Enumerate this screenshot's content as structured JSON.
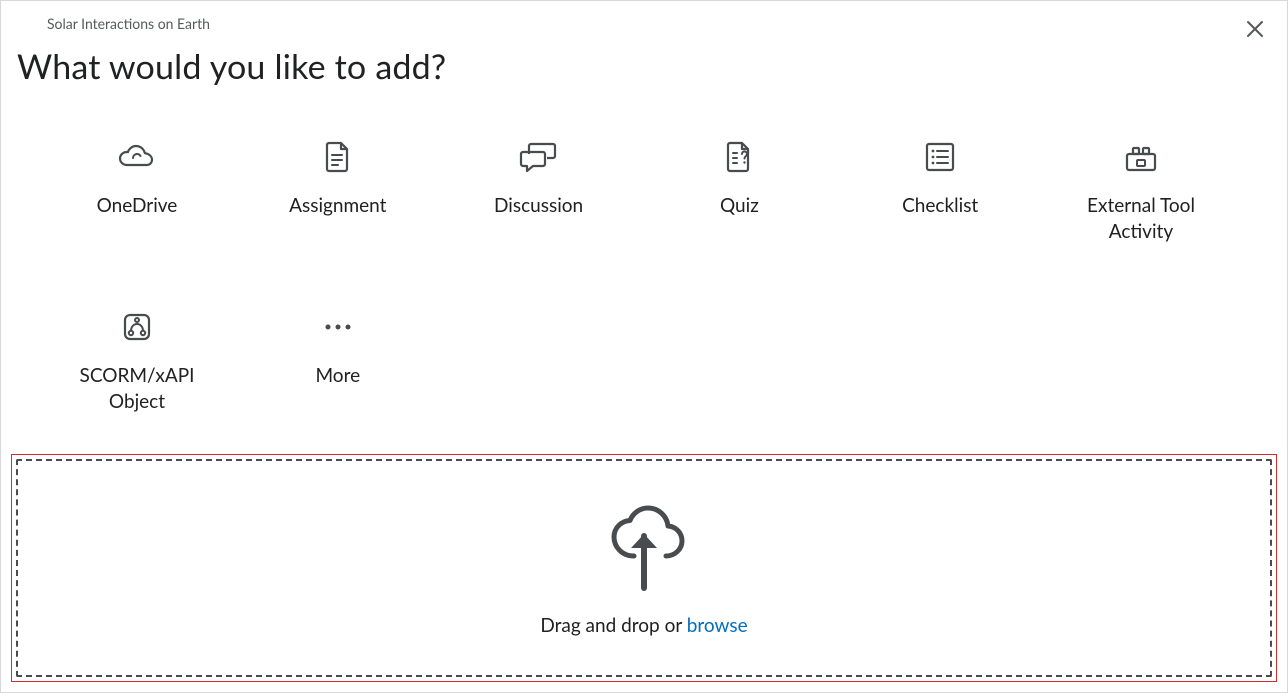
{
  "context": "Solar Interactions on Earth",
  "title": "What would you like to add?",
  "tiles": [
    {
      "label": "OneDrive"
    },
    {
      "label": "Assignment"
    },
    {
      "label": "Discussion"
    },
    {
      "label": "Quiz"
    },
    {
      "label": "Checklist"
    },
    {
      "label": "External Tool Activity"
    },
    {
      "label": "SCORM/xAPI Object"
    },
    {
      "label": "More"
    }
  ],
  "dropzone": {
    "prefix": "Drag and drop or ",
    "link": "browse"
  }
}
